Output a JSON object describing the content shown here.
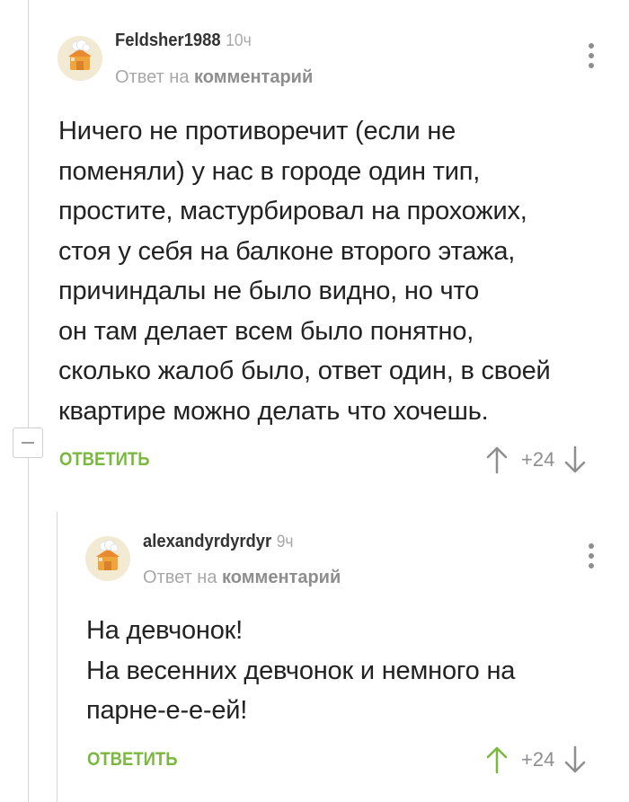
{
  "comments": [
    {
      "username": "Feldsher1988",
      "time": "10ч",
      "reply_prefix": "Ответ на",
      "reply_target": "комментарий",
      "text": "Ничего не противоречит (если не\nпоменяли) у нас в городе один тип,\nпростите, мастурбировал на прохожих,\nстоя у себя на балконе второго этажа,\nпричиндалы не было видно, но что\nон там делает всем было понятно,\nсколько жалоб было, ответ один, в своей\nквартире можно делать что хочешь.",
      "reply_label": "ОТВЕТИТЬ",
      "score": "+24",
      "upvoted": false
    },
    {
      "username": "alexandyrdyrdyr",
      "time": "9ч",
      "reply_prefix": "Ответ на",
      "reply_target": "комментарий",
      "text": "На девчонок!\nНа весенних девчонок и немного на\nпарне-е-е-ей!",
      "reply_label": "ОТВЕТИТЬ",
      "score": "+24",
      "upvoted": true
    }
  ],
  "colors": {
    "accent_green": "#7bb83f",
    "muted_gray": "#8e8e8e"
  },
  "icons": {
    "avatar": "chef-hat-house-avatar",
    "more": "vertical-dots-icon",
    "upvote": "arrow-up-icon",
    "downvote": "arrow-down-icon",
    "collapse": "minus-icon"
  }
}
